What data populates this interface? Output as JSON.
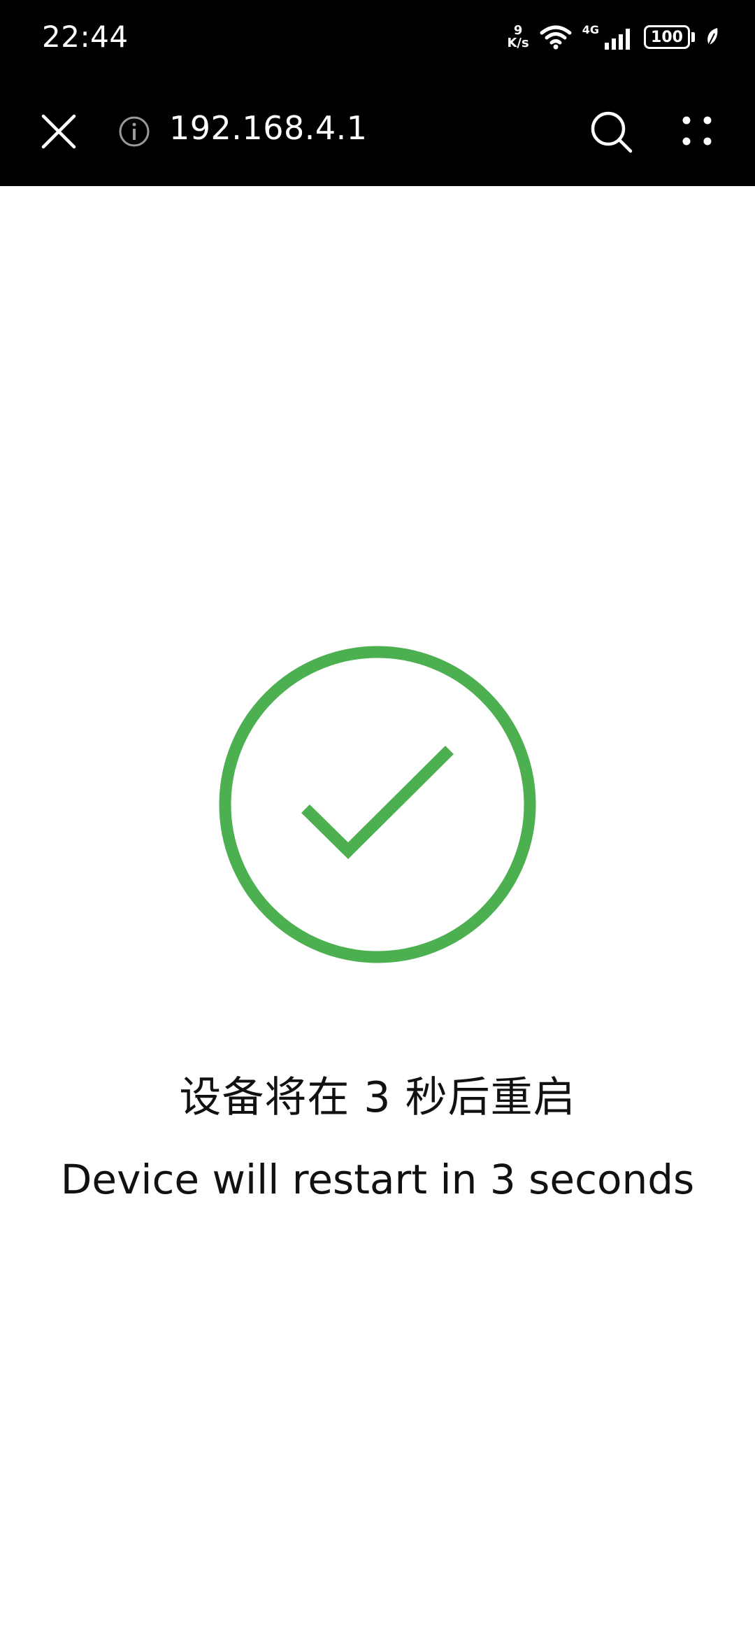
{
  "status_bar": {
    "time": "22:44",
    "net_speed_value": "9",
    "net_speed_unit": "K/s",
    "network_type": "4G",
    "battery_level": "100",
    "icons": [
      "wifi-icon",
      "signal-icon",
      "battery-icon",
      "leaf-icon"
    ]
  },
  "browser": {
    "url": "192.168.4.1",
    "icons": [
      "close-icon",
      "info-icon",
      "search-icon",
      "more-icon"
    ]
  },
  "main": {
    "message_zh": "设备将在 3 秒后重启",
    "message_en": "Device will restart in 3 seconds",
    "status_icon": "check-circle-icon",
    "accent_color": "#4caf50"
  }
}
